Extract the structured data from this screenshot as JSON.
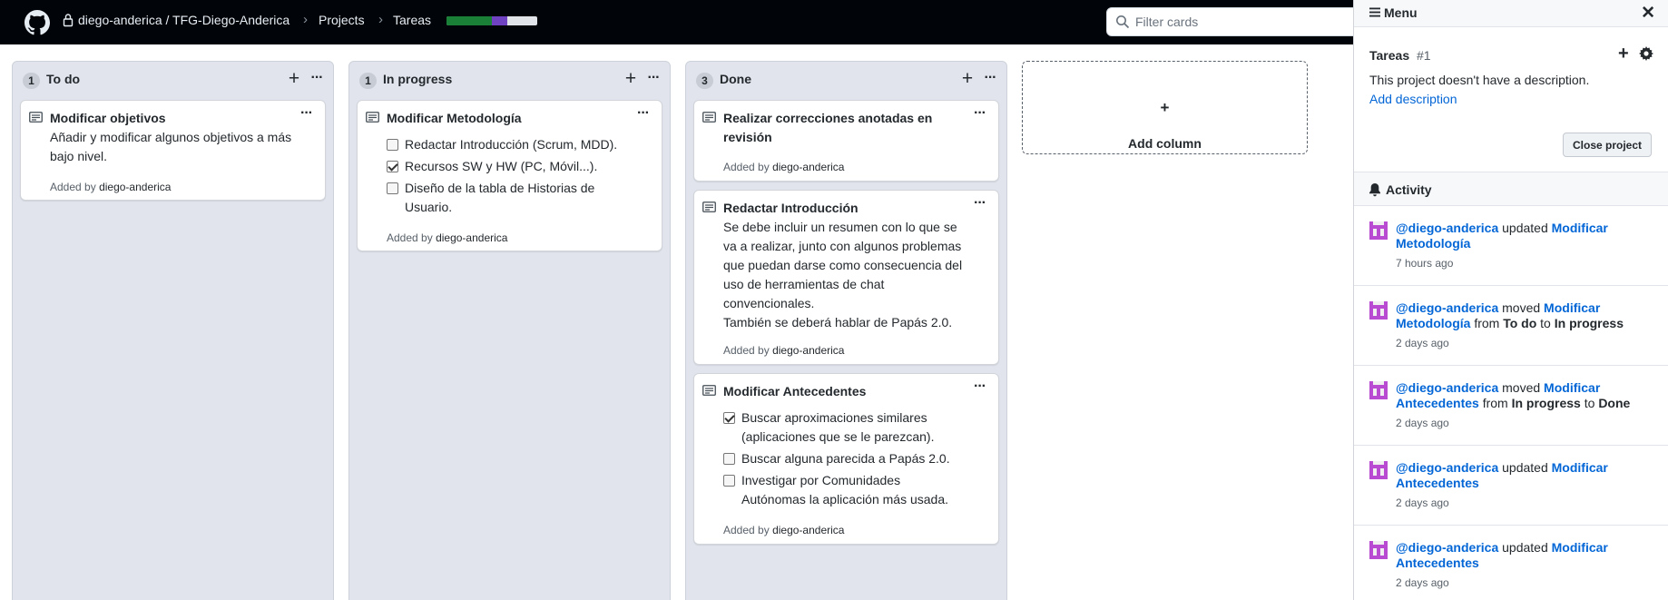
{
  "header": {
    "repo": "diego-anderica / TFG-Diego-Anderica",
    "crumb_projects": "Projects",
    "crumb_project": "Tareas",
    "progress": [
      {
        "fraction": 0.5,
        "color": "#1a7f37"
      },
      {
        "fraction": 0.17,
        "color": "#6f42c1"
      },
      {
        "fraction": 0.17,
        "color": "#e1e4e8"
      }
    ],
    "filter_placeholder": "Filter cards"
  },
  "columns": [
    {
      "count": "1",
      "title": "To do",
      "cards": [
        {
          "title": "Modificar objetivos",
          "body": "Añadir y modificar algunos objetivos a más bajo nivel.",
          "added_prefix": "Added by",
          "added_by": "diego-anderica"
        }
      ]
    },
    {
      "count": "1",
      "title": "In progress",
      "cards": [
        {
          "title": "Modificar Metodología",
          "tasks": [
            {
              "text": "Redactar Introducción (Scrum, MDD).",
              "checked": false
            },
            {
              "text": "Recursos SW y HW (PC, Móvil...).",
              "checked": true
            },
            {
              "text": "Diseño de la tabla de Historias de Usuario.",
              "checked": false
            }
          ],
          "added_prefix": "Added by",
          "added_by": "diego-anderica"
        }
      ]
    },
    {
      "count": "3",
      "title": "Done",
      "cards": [
        {
          "title": "Realizar correcciones anotadas en revisión",
          "added_prefix": "Added by",
          "added_by": "diego-anderica"
        },
        {
          "title": "Redactar Introducción",
          "body": "Se debe incluir un resumen con lo que se va a realizar, junto con algunos problemas que puedan darse como consecuencia del uso de herramientas de chat convencionales.",
          "body2": "También se deberá hablar de Papás 2.0.",
          "added_prefix": "Added by",
          "added_by": "diego-anderica"
        },
        {
          "title": "Modificar Antecedentes",
          "tasks": [
            {
              "text": "Buscar aproximaciones similares (aplicaciones que se le parezcan).",
              "checked": true
            },
            {
              "text": "Buscar alguna parecida a Papás 2.0.",
              "checked": false
            },
            {
              "text": "Investigar por Comunidades Autónomas la aplicación más usada.",
              "checked": false
            }
          ],
          "added_prefix": "Added by",
          "added_by": "diego-anderica"
        }
      ]
    }
  ],
  "add_column_label": "Add column",
  "panel": {
    "menu_title": "Menu",
    "project_name": "Tareas",
    "project_number": "#1",
    "description": "This project doesn't have a description.",
    "add_description": "Add description",
    "close_project": "Close project",
    "activity_title": "Activity",
    "activity": [
      {
        "user": "@diego-anderica",
        "action": "updated",
        "target": "Modificar Metodología",
        "time": "7 hours ago"
      },
      {
        "user": "@diego-anderica",
        "action": "moved",
        "target": "Modificar Metodología",
        "from_word": "from",
        "from": "To do",
        "to_word": "to",
        "to": "In progress",
        "time": "2 days ago"
      },
      {
        "user": "@diego-anderica",
        "action": "moved",
        "target": "Modificar Antecedentes",
        "from_word": "from",
        "from": "In progress",
        "to_word": "to",
        "to": "Done",
        "time": "2 days ago"
      },
      {
        "user": "@diego-anderica",
        "action": "updated",
        "target": "Modificar Antecedentes",
        "time": "2 days ago"
      },
      {
        "user": "@diego-anderica",
        "action": "updated",
        "target": "Modificar Antecedentes",
        "time": "2 days ago"
      }
    ]
  },
  "colors": {
    "topbar": "#010409",
    "link": "#0366d6",
    "column_bg": "#e1e4ec",
    "avatar": "#b84bd1"
  }
}
